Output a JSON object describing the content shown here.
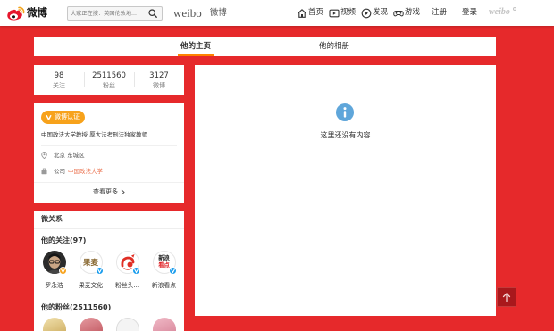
{
  "header": {
    "logo_text": "微博",
    "search_placeholder": "大家正在搜：英国伦敦地...",
    "brand_en": "weibo",
    "brand_cn": "微博",
    "nav": [
      {
        "label": "首页",
        "icon": "home-icon"
      },
      {
        "label": "视频",
        "icon": "video-icon"
      },
      {
        "label": "发现",
        "icon": "discover-icon"
      },
      {
        "label": "游戏",
        "icon": "game-icon"
      }
    ],
    "register": "注册",
    "login": "登录",
    "corner_logo": "weibo"
  },
  "tabs": [
    {
      "label": "他的主页",
      "active": true
    },
    {
      "label": "他的相册",
      "active": false
    }
  ],
  "stats": [
    {
      "value": "98",
      "label": "关注"
    },
    {
      "value": "2511560",
      "label": "粉丝"
    },
    {
      "value": "3127",
      "label": "微博"
    }
  ],
  "profile": {
    "badge": "微博认证",
    "bio": "中国政法大学教授 厚大法考刑法独家教师",
    "location": "北京 东城区",
    "company_label": "公司",
    "company": "中国政法大学",
    "more": "查看更多"
  },
  "relations": {
    "title": "微关系",
    "following_title": "他的关注(97)",
    "following": [
      {
        "name": "罗永浩",
        "badge_color": "#f7a21b"
      },
      {
        "name": "果麦文化",
        "badge_color": "#1b9ded",
        "logo_text": "果麦"
      },
      {
        "name": "粉丝头...",
        "badge_color": "#1b9ded"
      },
      {
        "name": "新浪看点",
        "badge_color": "#1b9ded",
        "logo_lines": [
          "新浪",
          "看点"
        ]
      }
    ],
    "fans_title": "他的粉丝(2511560)"
  },
  "main": {
    "icon": "info-icon",
    "empty_text": "这里还没有内容"
  },
  "scroll_top": {
    "icon": "arrow-up-icon"
  },
  "colors": {
    "page_bg": "#e6292b",
    "accent": "#ff8200",
    "badge": "#f7a21b",
    "link": "#eb7350",
    "info": "#5fa6da"
  }
}
